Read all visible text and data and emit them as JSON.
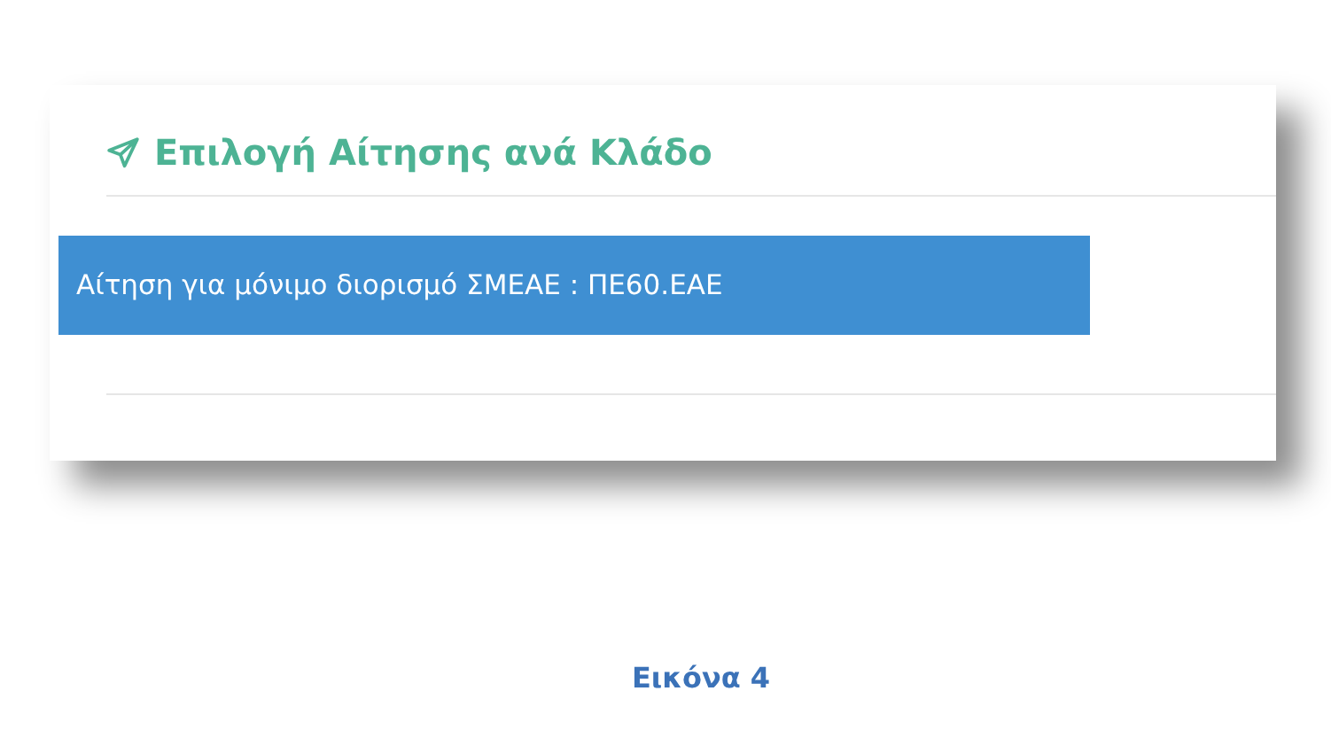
{
  "panel": {
    "title": "Επιλογή Αίτησης ανά Κλάδο",
    "items": [
      {
        "label": "Αίτηση για μόνιμο διορισμό ΣΜΕΑΕ : ΠΕ60.ΕΑΕ",
        "selected": true
      }
    ]
  },
  "caption": "Εικόνα 4"
}
